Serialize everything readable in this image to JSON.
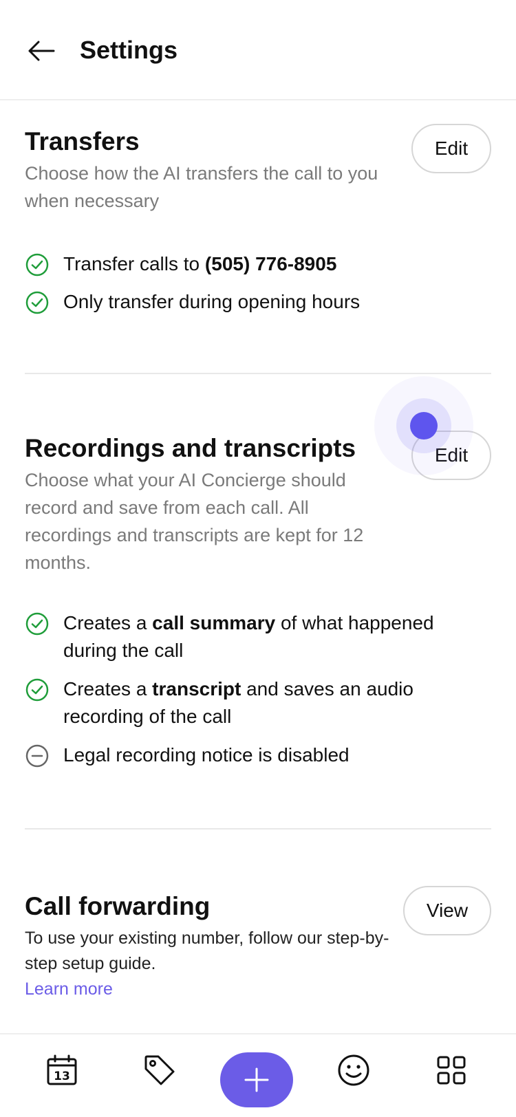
{
  "header": {
    "title": "Settings",
    "back_icon": "arrow-left-icon"
  },
  "transfers": {
    "title": "Transfers",
    "description": "Choose how the AI transfers the call to you when necessary",
    "edit_label": "Edit",
    "items": [
      {
        "icon": "check-circle-icon",
        "text_before": "Transfer calls to ",
        "bold": "(505) 776-8905",
        "text_after": ""
      },
      {
        "icon": "check-circle-icon",
        "text_before": "Only transfer during opening hours",
        "bold": "",
        "text_after": ""
      }
    ]
  },
  "recordings": {
    "title": "Recordings and transcripts",
    "description": "Choose what your AI Concierge should record and save from each call. All recordings and transcripts are kept for 12 months.",
    "edit_label": "Edit",
    "items": [
      {
        "icon": "check-circle-icon",
        "text_before": "Creates a ",
        "bold": "call summary",
        "text_after": " of what happened during the call"
      },
      {
        "icon": "check-circle-icon",
        "text_before": "Creates a ",
        "bold": "transcript",
        "text_after": " and saves an audio recording of the call"
      },
      {
        "icon": "minus-circle-icon",
        "text_before": "Legal recording notice is disabled",
        "bold": "",
        "text_after": ""
      }
    ]
  },
  "forwarding": {
    "title": "Call forwarding",
    "description": "To use your existing number, follow our step-by-step setup guide.",
    "link_label": "Learn more",
    "view_label": "View"
  },
  "bottom_nav": {
    "calendar_day": "13",
    "items": [
      "calendar-icon",
      "tag-icon",
      "plus-icon",
      "smiley-icon",
      "grid-icon"
    ]
  },
  "colors": {
    "accent": "#6b5ce7",
    "check_green": "#1f9d3a",
    "muted_text": "#7a7a7a"
  }
}
